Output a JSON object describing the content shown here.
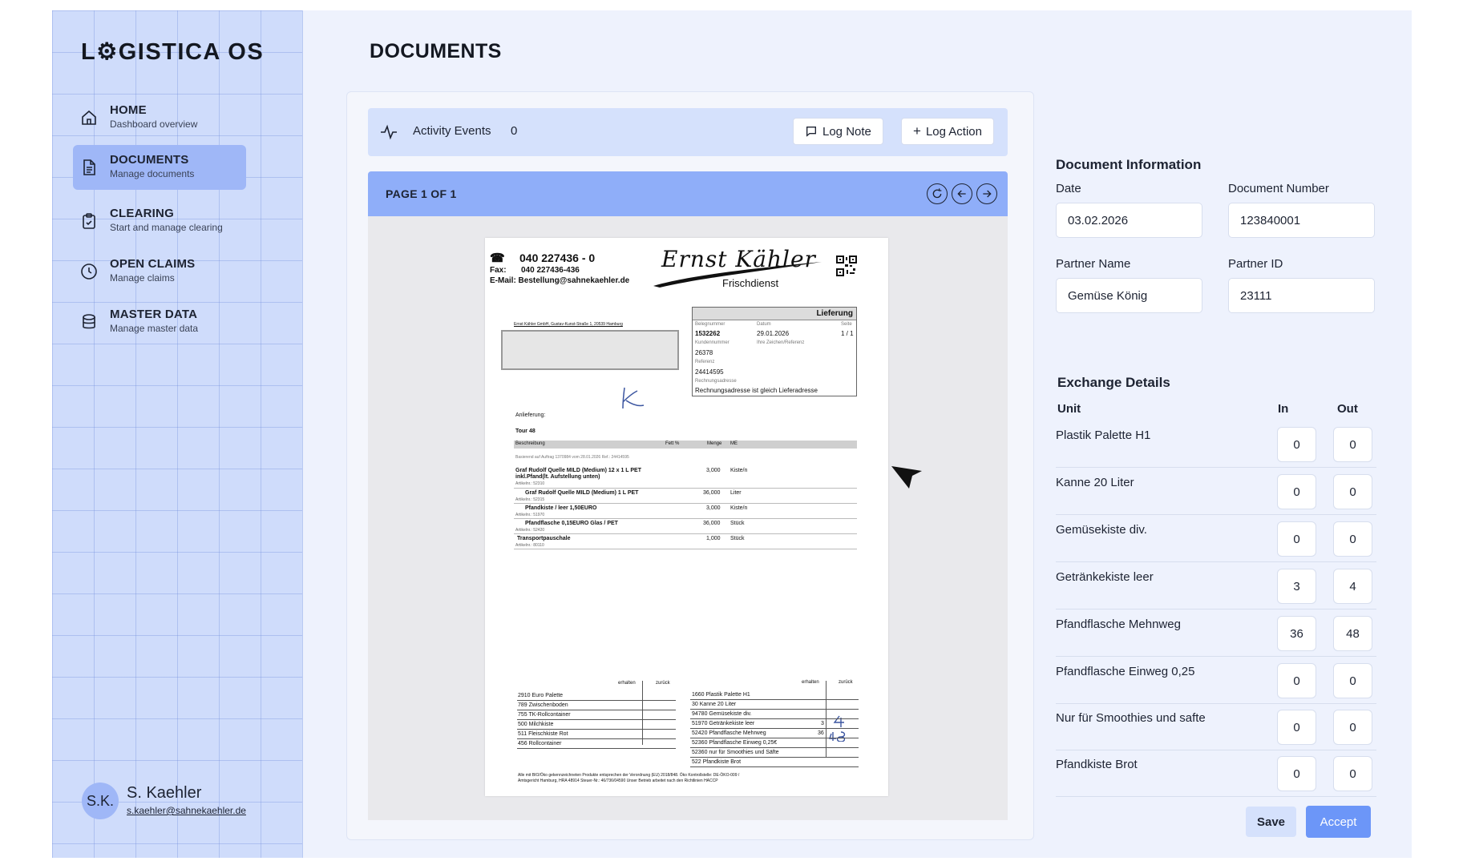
{
  "app": {
    "logo": "L⚙GISTICA OS"
  },
  "sidebar": {
    "items": [
      {
        "title": "HOME",
        "subtitle": "Dashboard overview"
      },
      {
        "title": "DOCUMENTS",
        "subtitle": "Manage documents"
      },
      {
        "title": "CLEARING",
        "subtitle": "Start and manage clearing"
      },
      {
        "title": "OPEN CLAIMS",
        "subtitle": "Manage claims"
      },
      {
        "title": "MASTER DATA",
        "subtitle": "Manage master data"
      }
    ],
    "active_index": 1
  },
  "user": {
    "initials": "S.K.",
    "name": "S. Kaehler",
    "email": "s.kaehler@sahnekaehler.de"
  },
  "main": {
    "title": "DOCUMENTS"
  },
  "activity": {
    "label": "Activity Events",
    "count": "0",
    "log_note": "Log Note",
    "log_action": "Log Action"
  },
  "viewer": {
    "page_label": "PAGE 1 OF 1"
  },
  "scan": {
    "phone": "040 227436 - 0",
    "fax_label": "Fax:",
    "fax": "040 227436-436",
    "email": "E-Mail: Bestellung@sahnekaehler.de",
    "signature_logo": "Ernst Kähler",
    "brand_sub": "Frischdienst",
    "doc_type": "Lieferung",
    "sender_line": "Ernst Kähler GmbH, Gustav-Kunst-Straße 1, 20539 Hamburg",
    "beleg_label": "Belegnummer",
    "datum_label": "Datum",
    "seite_label": "Seite",
    "beleg": "1532262",
    "datum": "29.01.2026",
    "seite": "1 / 1",
    "kunde_label": "Kundennummer",
    "zeichen_label": "Ihre Zeichen/Referenz",
    "kunde": "26378",
    "referenz_label": "Referenz",
    "referenz": "24414595",
    "rechnung_label": "Rechnungsadresse",
    "rechnung": "Rechnungsadresse ist gleich Lieferadresse",
    "anlieferung": "Anlieferung:",
    "tour": "Tour 48",
    "col_desc": "Beschreibung",
    "col_fett": "Fett %",
    "col_menge": "Menge",
    "col_me": "ME",
    "basis": "Basierend auf Auftrag 1370984 vom 28.01.2026   Ref.: 24414595",
    "lines": [
      {
        "desc": "Graf Rudolf Quelle MILD (Medium) 12 x 1 L PET",
        "desc2": "inkl.Pfand(lt. Aufstellung unten)",
        "art": "Artikelnr.: 52310",
        "qty": "3,000",
        "unit": "Kiste/n"
      },
      {
        "desc": "Graf Rudolf Quelle MILD (Medium)  1 L PET",
        "art": "Artikelnr.: 52315",
        "qty": "36,000",
        "unit": "Liter"
      },
      {
        "desc": "Pfandkiste / leer 1,50EURO",
        "art": "Artikelnr.: 51970",
        "qty": "3,000",
        "unit": "Kiste/n"
      },
      {
        "desc": "Pfandflasche 0,15EURO Glas / PET",
        "art": "Artikelnr.: 52420",
        "qty": "36,000",
        "unit": "Stück"
      },
      {
        "desc": "Transportpauschale",
        "art": "Artikelnr.: 80110",
        "qty": "1,000",
        "unit": "Stück"
      }
    ],
    "erhalten": "erhalten",
    "zurueck": "zurück",
    "left_items": [
      "2910 Euro Palette",
      "789 Zwischenboden",
      "755 TK-Rollcontainer",
      "500 Milchkiste",
      "511 Fleischkiste Rot",
      "456 Rollcontainer"
    ],
    "right_items": [
      "1660 Plastik Palette H1",
      "30 Kanne 20 Liter",
      "94780 Gemüsekiste div.",
      "51970 Getränkekiste leer",
      "52420 Pfandflasche Mehrweg",
      "52360 Pfandflasche Einweg 0,25€",
      "52360 nur für Smoothies und Säfte",
      "522 Pfandkiste Brot"
    ],
    "right_vals": [
      "3",
      "36"
    ],
    "footer1": "Alle mit BIO/Öko gekennzeichneten Produkte entsprechen der Verordnung (EU) 2018/848. Öko Kontrollstelle: DE-ÖKO-009 /",
    "footer2": "Amtsgericht Hamburg, HRA 48914 Steuer-Nr.: 46/736/04590 Unser Betrieb arbeitet nach den Richtlinien HACCP"
  },
  "doc_info": {
    "title": "Document Information",
    "date_label": "Date",
    "date": "03.02.2026",
    "number_label": "Document Number",
    "number": "123840001",
    "partner_label": "Partner Name",
    "partner": "Gemüse König",
    "partner_id_label": "Partner ID",
    "partner_id": "23111"
  },
  "exchange": {
    "title": "Exchange Details",
    "col_unit": "Unit",
    "col_in": "In",
    "col_out": "Out",
    "rows": [
      {
        "unit": "Plastik Palette H1",
        "in": "0",
        "out": "0"
      },
      {
        "unit": "Kanne 20 Liter",
        "in": "0",
        "out": "0"
      },
      {
        "unit": "Gemüsekiste div.",
        "in": "0",
        "out": "0"
      },
      {
        "unit": "Getränkekiste leer",
        "in": "3",
        "out": "4"
      },
      {
        "unit": "Pfandflasche Mehnweg",
        "in": "36",
        "out": "48"
      },
      {
        "unit": "Pfandflasche  Einweg 0,25",
        "in": "0",
        "out": "0"
      },
      {
        "unit": "Nur für Smoothies und safte",
        "in": "0",
        "out": "0"
      },
      {
        "unit": "Pfandkiste Brot",
        "in": "0",
        "out": "0"
      }
    ],
    "save": "Save",
    "accept": "Accept"
  }
}
